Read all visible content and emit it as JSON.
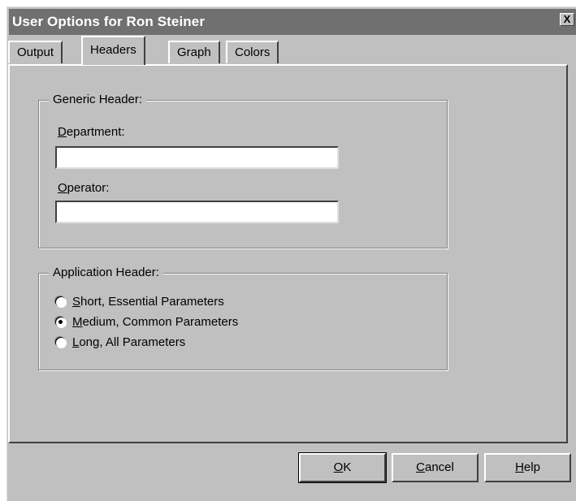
{
  "window": {
    "title": "User Options for Ron Steiner",
    "close_glyph": "X"
  },
  "tabs": [
    {
      "label": "Output",
      "active": false
    },
    {
      "label": "Headers",
      "active": true
    },
    {
      "label": "Graph",
      "active": false
    },
    {
      "label": "Colors",
      "active": false
    }
  ],
  "generic_header": {
    "legend": "Generic Header:",
    "department": {
      "label_first": "D",
      "label_rest": "epartment:",
      "value": ""
    },
    "operator": {
      "label_first": "O",
      "label_rest": "perator:",
      "value": ""
    }
  },
  "application_header": {
    "legend": "Application Header:",
    "options": [
      {
        "first": "S",
        "rest": "hort, Essential Parameters",
        "checked": false
      },
      {
        "first": "M",
        "rest": "edium, Common Parameters",
        "checked": true
      },
      {
        "first": "L",
        "rest": "ong, All Parameters",
        "checked": false
      }
    ]
  },
  "buttons": {
    "ok": {
      "first": "O",
      "rest": "K"
    },
    "cancel": {
      "first": "C",
      "rest": "ancel"
    },
    "help": {
      "first": "H",
      "rest": "elp"
    }
  }
}
